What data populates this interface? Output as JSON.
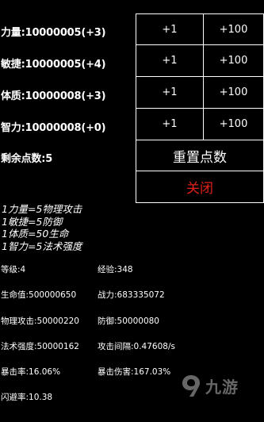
{
  "attributes": [
    {
      "label": "力量:10000005(+3)",
      "plus1": "+1",
      "plus100": "+100"
    },
    {
      "label": "敏捷:10000005(+4)",
      "plus1": "+1",
      "plus100": "+100"
    },
    {
      "label": "体质:10000008(+3)",
      "plus1": "+1",
      "plus100": "+100"
    },
    {
      "label": "智力:10000008(+0)",
      "plus1": "+1",
      "plus100": "+100"
    }
  ],
  "remaining_points": "剩余点数:5",
  "reset_button": "重置点数",
  "close_button": "关闭",
  "rules": [
    "1力量=5物理攻击",
    "1敏捷=5防御",
    "1体质=50生命",
    "1智力=5法术强度"
  ],
  "stats": {
    "level": "等级:4",
    "exp": "经验:348",
    "hp": "生命值:500000650",
    "power": "战力:683335072",
    "phys_atk": "物理攻击:50000220",
    "defense": "防御:50000080",
    "magic": "法术强度:50000162",
    "atk_interval": "攻击间隔:0.47608/s",
    "crit_rate": "暴击率:16.06%",
    "crit_dmg": "暴击伤害:167.03%",
    "dodge": "闪避率:10.38"
  },
  "watermark": "九游",
  "colors": {
    "background": "#000000",
    "text": "#ffffff",
    "close_text": "#e0201a"
  }
}
